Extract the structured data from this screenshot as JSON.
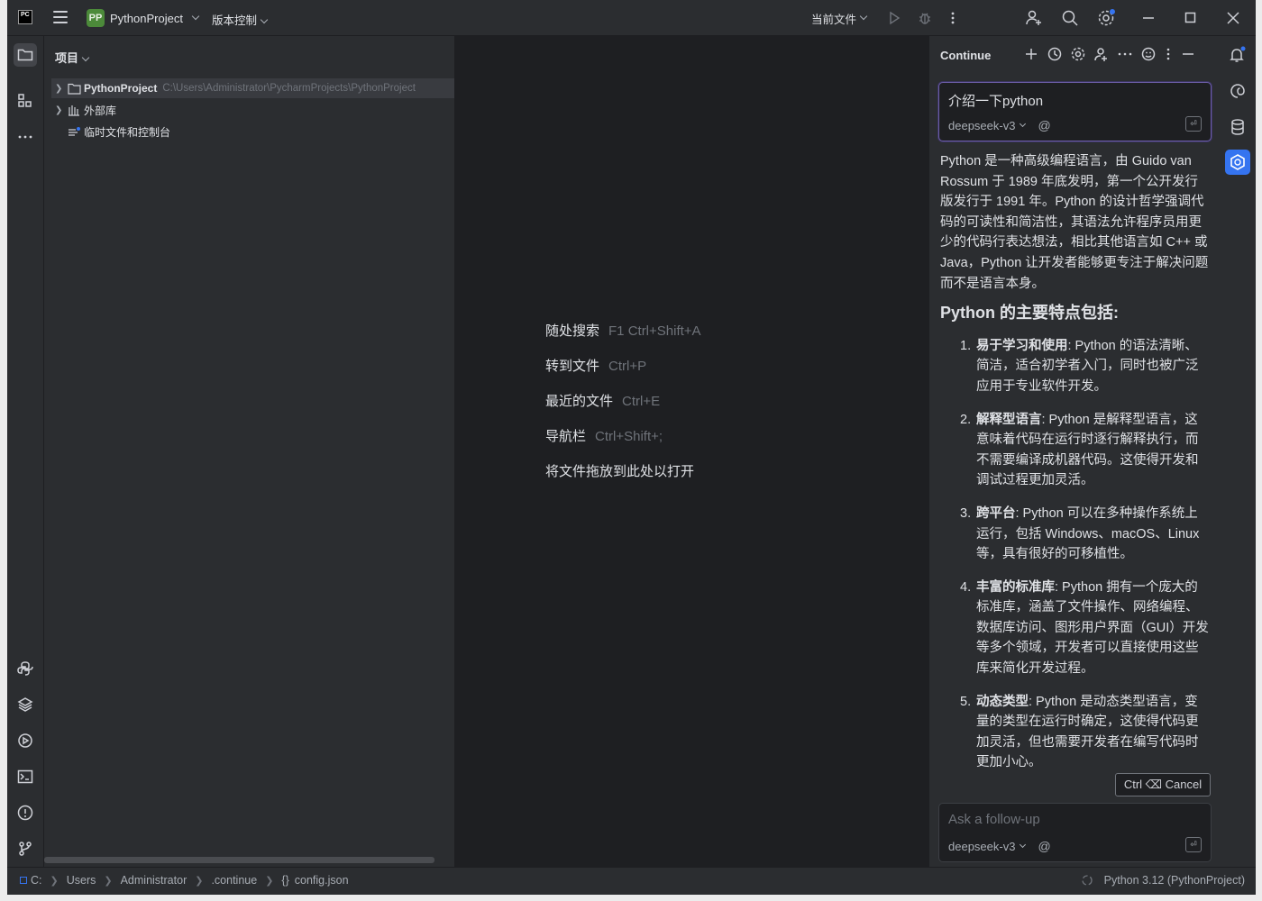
{
  "titlebar": {
    "logo": "PC",
    "project_badge": "PP",
    "project_name": "PythonProject",
    "vcs_label": "版本控制",
    "run_config": "当前文件"
  },
  "project_panel": {
    "title": "项目",
    "tree": [
      {
        "name": "PythonProject",
        "path": "C:\\Users\\Administrator\\PycharmProjects\\PythonProject"
      },
      {
        "name": "外部库"
      },
      {
        "name": "临时文件和控制台"
      }
    ]
  },
  "editor": {
    "hints": [
      {
        "label": "随处搜索",
        "key": "F1 Ctrl+Shift+A"
      },
      {
        "label": "转到文件",
        "key": "Ctrl+P"
      },
      {
        "label": "最近的文件",
        "key": "Ctrl+E"
      },
      {
        "label": "导航栏",
        "key": "Ctrl+Shift+;"
      },
      {
        "label": "将文件拖放到此处以打开",
        "key": ""
      }
    ]
  },
  "continue_panel": {
    "title": "Continue",
    "prompt": "介绍一下python",
    "model": "deepseek-v3",
    "at_symbol": "@",
    "enter_symbol": "⏎",
    "intro": "Python 是一种高级编程语言，由 Guido van Rossum 于 1989 年底发明，第一个公开发行版发行于 1991 年。Python 的设计哲学强调代码的可读性和简洁性，其语法允许程序员用更少的代码行表达想法，相比其他语言如 C++ 或 Java，Python 让开发者能够更专注于解决问题而不是语言本身。",
    "heading": "Python 的主要特点包括:",
    "features": [
      {
        "num": "1.",
        "title": "易于学习和使用",
        "text": ": Python 的语法清晰、简洁，适合初学者入门，同时也被广泛应用于专业软件开发。"
      },
      {
        "num": "2.",
        "title": "解释型语言",
        "text": ": Python 是解释型语言，这意味着代码在运行时逐行解释执行，而不需要编译成机器代码。这使得开发和调试过程更加灵活。"
      },
      {
        "num": "3.",
        "title": "跨平台",
        "text": ": Python 可以在多种操作系统上运行，包括 Windows、macOS、Linux 等，具有很好的可移植性。"
      },
      {
        "num": "4.",
        "title": "丰富的标准库",
        "text": ": Python 拥有一个庞大的标准库，涵盖了文件操作、网络编程、数据库访问、图形用户界面（GUI）开发等多个领域，开发者可以直接使用这些库来简化开发过程。"
      },
      {
        "num": "5.",
        "title": "动态类型",
        "text": ": Python 是动态类型语言，变量的类型在运行时确定，这使得代码更加灵活，但也需要开发者在编写代码时更加小心。"
      }
    ],
    "cancel_label": "Ctrl ⌫ Cancel",
    "followup_placeholder": "Ask a follow-up",
    "followup_model": "deepseek-v3"
  },
  "statusbar": {
    "breadcrumb": [
      "C:",
      "Users",
      "Administrator",
      ".continue",
      "config.json"
    ],
    "interpreter": "Python 3.12 (PythonProject)"
  },
  "colors": {
    "accent": "#3574f0",
    "panel_bg": "#2b2d30",
    "editor_bg": "#1e1f22",
    "project_badge": "#4c8a3a",
    "input_focus": "#6d5ea8"
  }
}
